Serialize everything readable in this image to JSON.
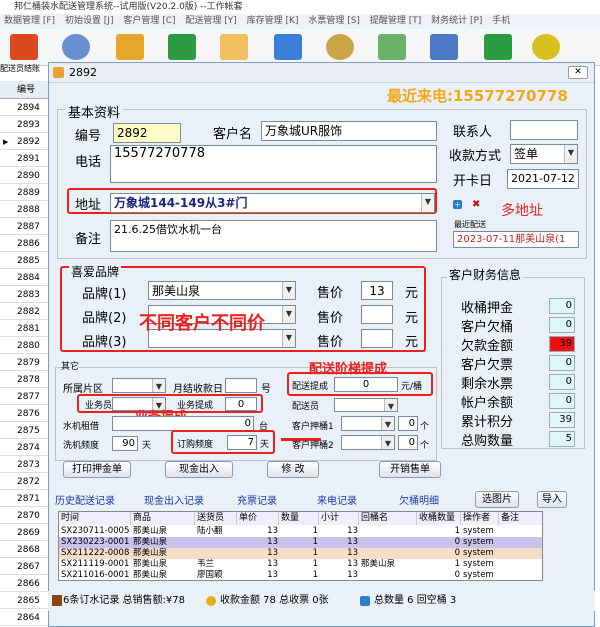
{
  "app": {
    "title": "邦仁桶装水配送管理系统--试用版(V20.2.0版) --工作帐套"
  },
  "menu": [
    "数据管理 [F]",
    "初始设置 [J]",
    "客户管理 [C]",
    "配送管理 [Y]",
    "库存管理 [K]",
    "水票管理 [S]",
    "提醒管理 [T]",
    "财务统计 [P]",
    "手机"
  ],
  "toolbar_icons": [
    "chart-icon",
    "add-customer-icon",
    "hand-money-icon",
    "refresh-icon",
    "copy-icon",
    "edit-icon",
    "money-bag-icon",
    "keyboard-icon",
    "calculator-icon",
    "search-icon"
  ],
  "left": {
    "header": "配送员结账",
    "col": "编号",
    "rows": [
      "2894",
      "2893",
      "2892",
      "2891",
      "2890",
      "2889",
      "2888",
      "2887",
      "2886",
      "2885",
      "2884",
      "2883",
      "2882",
      "2881",
      "2880",
      "2879",
      "2878",
      "2877",
      "2876",
      "2875",
      "2874",
      "2873",
      "2872",
      "2871",
      "2870",
      "2869",
      "2868",
      "2867",
      "2866",
      "2865",
      "2864"
    ]
  },
  "dialog": {
    "title": "2892",
    "recent_call": "最近来电:15577270778",
    "basic_title": "基本资料",
    "code_label": "编号",
    "code": "2892",
    "name_label": "客户名",
    "name": "万象城UR服饰",
    "contact_label": "联系人",
    "contact": "",
    "phone_label": "电话",
    "phone": "15577270778",
    "pay_label": "收款方式",
    "pay": "签单",
    "open_label": "开卡日",
    "open": "2021-07-12",
    "addr_label": "地址",
    "addr": "万象城144-149从3#门",
    "multi_addr_note": "多地址",
    "last_delivery_label": "最近配送",
    "last_delivery": "2023-07-11那美山泉(1",
    "note_label": "备注",
    "note": "21.6.25借饮水机一台",
    "brand_title": "喜爱品牌",
    "brands": [
      {
        "label": "品牌(1)",
        "value": "那美山泉",
        "price_label": "售价",
        "price": "13",
        "unit": "元"
      },
      {
        "label": "品牌(2)",
        "value": "",
        "price_label": "售价",
        "price": "",
        "unit": "元"
      },
      {
        "label": "品牌(3)",
        "value": "",
        "price_label": "售价",
        "price": "",
        "unit": "元"
      }
    ],
    "price_note": "不同客户不同价",
    "fin_title": "客户财务信息",
    "fin": [
      {
        "label": "收桶押金",
        "value": "0"
      },
      {
        "label": "客户欠桶",
        "value": "0"
      },
      {
        "label": "欠款金额",
        "value": "39"
      },
      {
        "label": "客户欠票",
        "value": "0"
      },
      {
        "label": "剩余水票",
        "value": "0"
      },
      {
        "label": "帐户余额",
        "value": "0"
      },
      {
        "label": "累计积分",
        "value": "39"
      },
      {
        "label": "总购数量",
        "value": "5"
      }
    ],
    "other_title": "其它",
    "area_label": "所属片区",
    "monthly_label": "月结收款日",
    "monthly_unit": "号",
    "deliver_comm_label": "配送提成",
    "deliver_comm": "0",
    "deliver_comm_unit": "元/桶",
    "tier_note": "配送阶梯提成",
    "sales_label": "业务员",
    "sales_comm_label": "业务提成",
    "sales_comm": "0",
    "sales_note": "业务提成",
    "deliverer_label": "配送员",
    "machine_label": "水机租借",
    "machine": "0",
    "machine_unit": "台",
    "lockbox1_label": "客户押桶1",
    "lockbox1": "0",
    "lockbox_unit": "个",
    "wash_label": "洗机频度",
    "wash": "90",
    "wash_unit": "天",
    "freq_label": "订购频度",
    "freq": "7",
    "freq_unit": "天",
    "lockbox2_label": "客户押桶2",
    "lockbox2": "0",
    "buttons": [
      "打印押金单",
      "现金出入",
      "修 改",
      "开销售单"
    ],
    "tabs": [
      "历史配送记录",
      "现金出入记录",
      "充票记录",
      "来电记录",
      "欠桶明细"
    ],
    "pick_image": "选图片",
    "import": "导入",
    "grid_cols": [
      "时间",
      "商品",
      "送货员",
      "单价",
      "数量",
      "小计",
      "回桶名",
      "收桶数量",
      "操作者",
      "备注"
    ],
    "grid_rows": [
      [
        "SX230711-0005",
        "那美山泉",
        "陆小翻",
        "13",
        "1",
        "13",
        "",
        "1",
        "system",
        ""
      ],
      [
        "SX230223-0001",
        "那美山泉",
        "",
        "13",
        "1",
        "13",
        "",
        "0",
        "system",
        ""
      ],
      [
        "SX211222-0008",
        "那美山泉",
        "",
        "13",
        "1",
        "13",
        "",
        "0",
        "system",
        ""
      ],
      [
        "SX211119-0001",
        "那美山泉",
        "韦兰",
        "13",
        "1",
        "13",
        "那美山泉",
        "1",
        "system",
        ""
      ],
      [
        "SX211016-0001",
        "那美山泉",
        "廖国颖",
        "13",
        "1",
        "13",
        "",
        "0",
        "system",
        ""
      ]
    ]
  },
  "status": {
    "s1": "6条订水记录 总销售额:¥78",
    "s2": "收款金额 78 总收票 0张",
    "s3": "总数量 6 回空桶 3"
  }
}
